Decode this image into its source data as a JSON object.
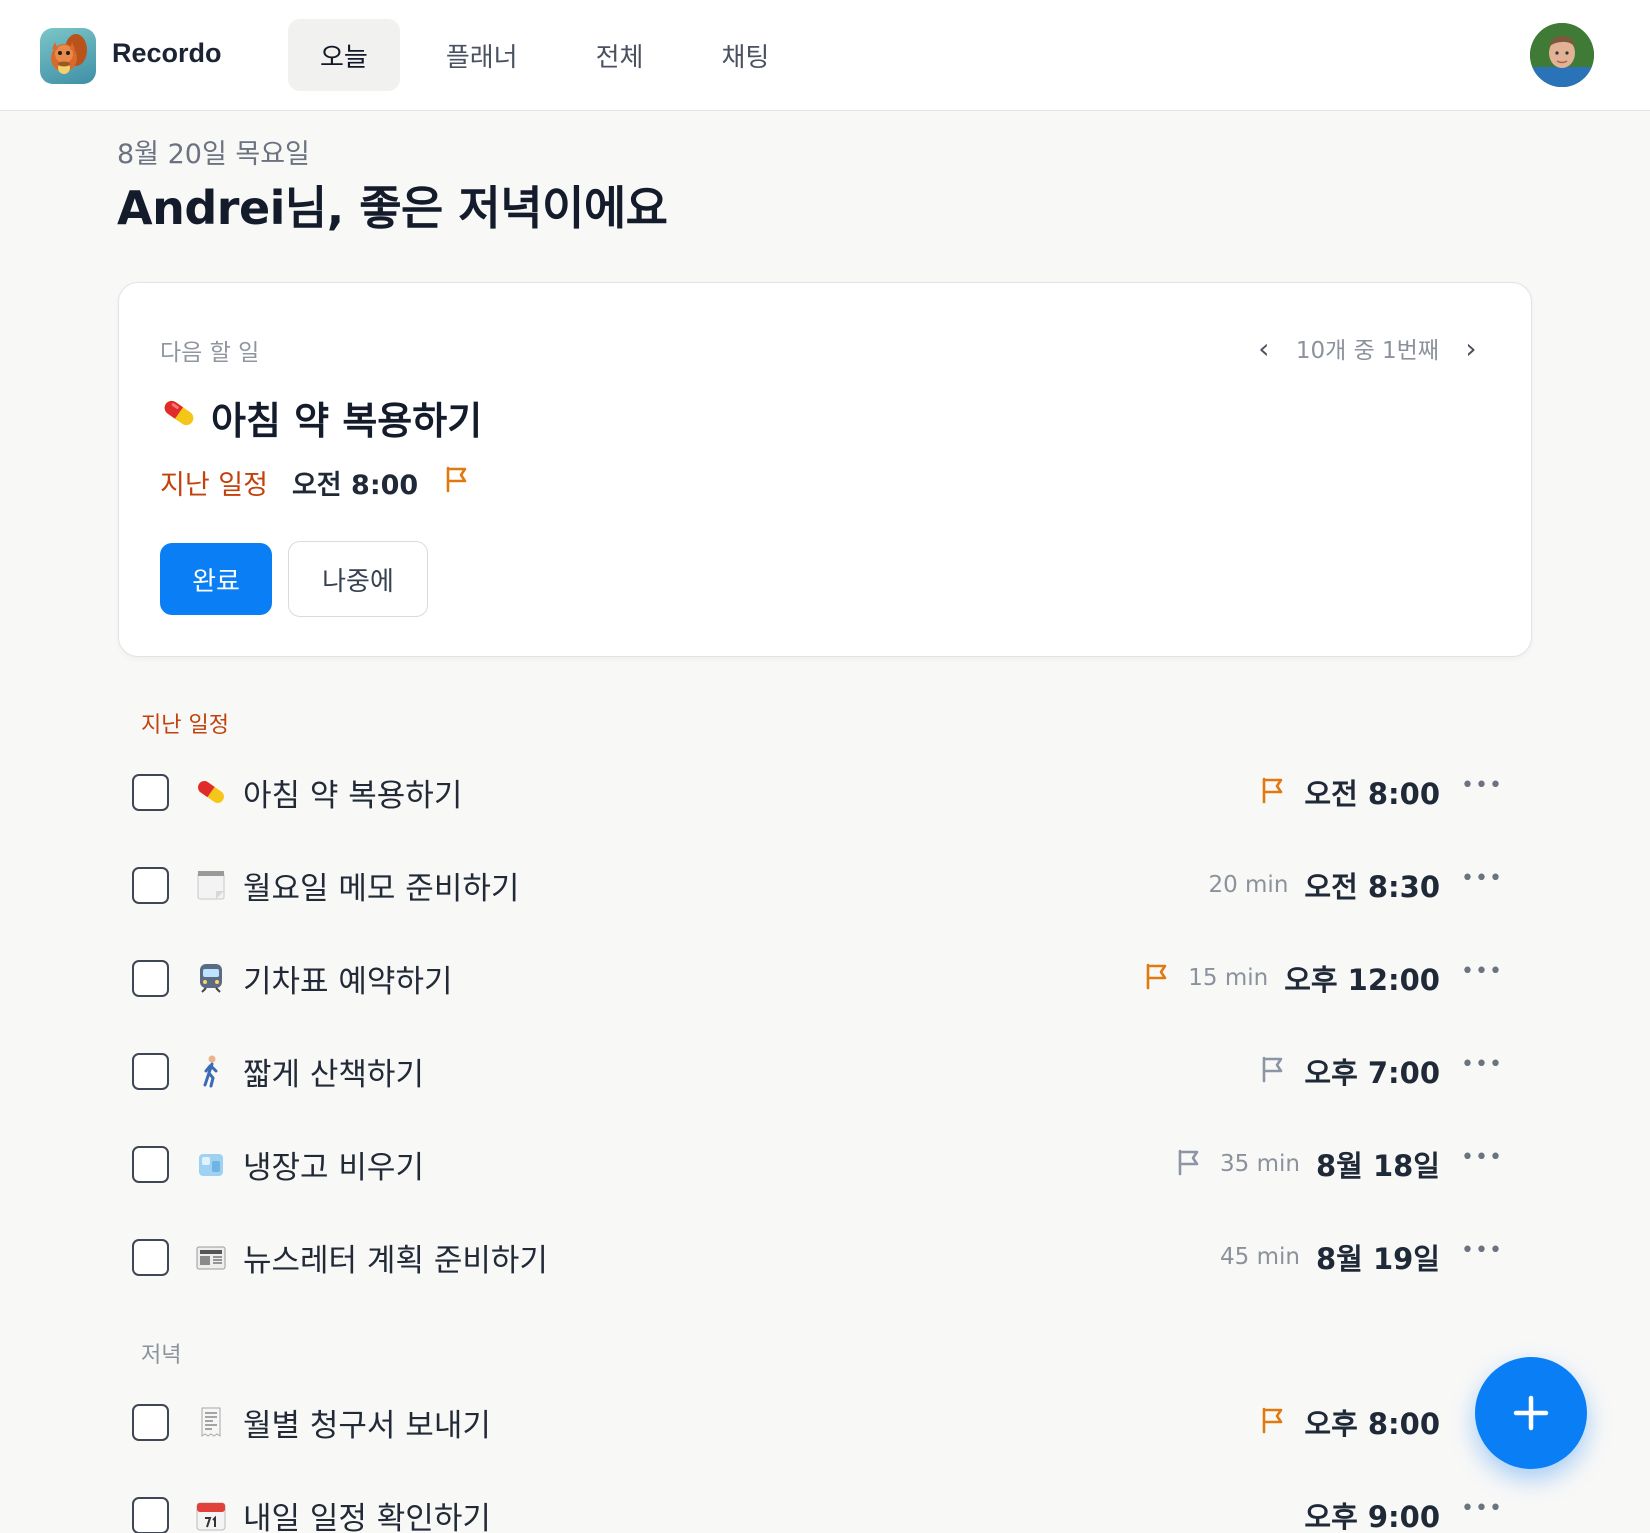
{
  "app": {
    "brand": "Recordo"
  },
  "nav": {
    "tabs": [
      {
        "label": "오늘",
        "active": true
      },
      {
        "label": "플래너",
        "active": false
      },
      {
        "label": "전체",
        "active": false
      },
      {
        "label": "채팅",
        "active": false
      }
    ]
  },
  "header": {
    "date": "8월 20일 목요일",
    "greeting": "Andrei님, 좋은 저녁이에요"
  },
  "next_task": {
    "label": "다음 할 일",
    "pager": "10개 중 1번째",
    "emoji": "pill-icon",
    "title": "아침 약 복용하기",
    "status": "지난 일정",
    "time": "오전 8:00",
    "flag": "flag-icon",
    "done_label": "완료",
    "later_label": "나중에"
  },
  "sections": [
    {
      "title": "지난 일정",
      "color": "#c2410c",
      "items": [
        {
          "icon": "pill-icon",
          "title": "아침 약 복용하기",
          "flag": "orange",
          "duration": "",
          "time": "오전 8:00"
        },
        {
          "icon": "notepad-icon",
          "title": "월요일 메모 준비하기",
          "flag": "",
          "duration": "20 min",
          "time": "오전 8:30"
        },
        {
          "icon": "train-icon",
          "title": "기차표 예약하기",
          "flag": "orange",
          "duration": "15 min",
          "time": "오후 12:00"
        },
        {
          "icon": "walking-person-icon",
          "title": "짧게 산책하기",
          "flag": "gray",
          "duration": "",
          "time": "오후 7:00"
        },
        {
          "icon": "ice-cube-icon",
          "title": "냉장고 비우기",
          "flag": "gray",
          "duration": "35 min",
          "time": "8월 18일"
        },
        {
          "icon": "newspaper-icon",
          "title": "뉴스레터 계획 준비하기",
          "flag": "",
          "duration": "45 min",
          "time": "8월 19일"
        }
      ]
    },
    {
      "title": "저녁",
      "color": "#8b929c",
      "items": [
        {
          "icon": "receipt-icon",
          "title": "월별 청구서 보내기",
          "flag": "orange",
          "duration": "",
          "time": "오후 8:00"
        },
        {
          "icon": "calendar-icon",
          "title": "내일 일정 확인하기",
          "flag": "",
          "duration": "",
          "time": "오후 9:00"
        }
      ]
    }
  ],
  "colors": {
    "accent": "#0a7ff5",
    "overdue": "#c2410c",
    "flag_orange": "#e07a10",
    "flag_gray": "#8b95a3"
  },
  "fab": {
    "icon": "plus-icon"
  }
}
